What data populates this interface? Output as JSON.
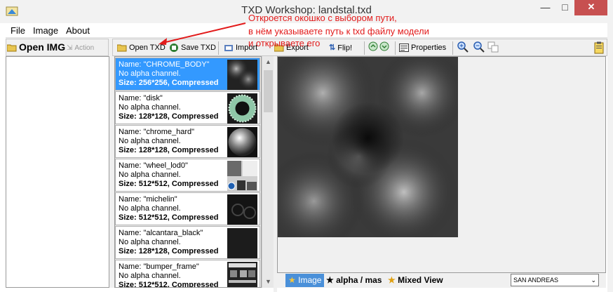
{
  "window": {
    "title": "TXD Workshop: landstal.txd",
    "minimize": "—",
    "maximize": "□",
    "close": "✕"
  },
  "menu": [
    "File",
    "Image",
    "About"
  ],
  "toolbar": {
    "open_img": "Open IMG",
    "action": "Action",
    "open_txd": "Open TXD",
    "save_txd": "Save TXD",
    "import": "Import",
    "export": "Export",
    "flip": "Flip!",
    "properties": "Properties"
  },
  "textures": [
    {
      "name": "Name: \"CHROME_BODY\"",
      "alpha": "No alpha channel.",
      "size": "Size: 256*256, Compressed",
      "thumb": "cloud-texture"
    },
    {
      "name": "Name: \"disk\"",
      "alpha": "No alpha channel.",
      "size": "Size: 128*128, Compressed",
      "thumb": "disk-texture"
    },
    {
      "name": "Name: \"chrome_hard\"",
      "alpha": "No alpha channel.",
      "size": "Size: 128*128, Compressed",
      "thumb": "chrome-sphere-texture"
    },
    {
      "name": "Name: \"wheel_lod0\"",
      "alpha": "No alpha channel.",
      "size": "Size: 512*512, Compressed",
      "thumb": "wheel-atlas-texture"
    },
    {
      "name": "Name: \"michelin\"",
      "alpha": "No alpha channel.",
      "size": "Size: 512*512, Compressed",
      "thumb": "tire-texture"
    },
    {
      "name": "Name: \"alcantara_black\"",
      "alpha": "No alpha channel.",
      "size": "Size: 128*128, Compressed",
      "thumb": "dark-fabric-texture"
    },
    {
      "name": "Name: \"bumper_frame\"",
      "alpha": "No alpha channel.",
      "size": "Size: 512*512, Compressed",
      "thumb": "bumper-texture"
    }
  ],
  "tabs": {
    "image": "Image",
    "alpha": "alpha / mas",
    "mixed": "Mixed View"
  },
  "game_select": "SAN ANDREAS",
  "annotation": {
    "line1": "Откроется окошко с выбором пути,",
    "line2": "в нём указываете путь к txd файлу модели",
    "line3": "и открываете его"
  },
  "colors": {
    "selection": "#3399ff",
    "annotation": "#e21b1b",
    "close_button": "#c75050"
  }
}
